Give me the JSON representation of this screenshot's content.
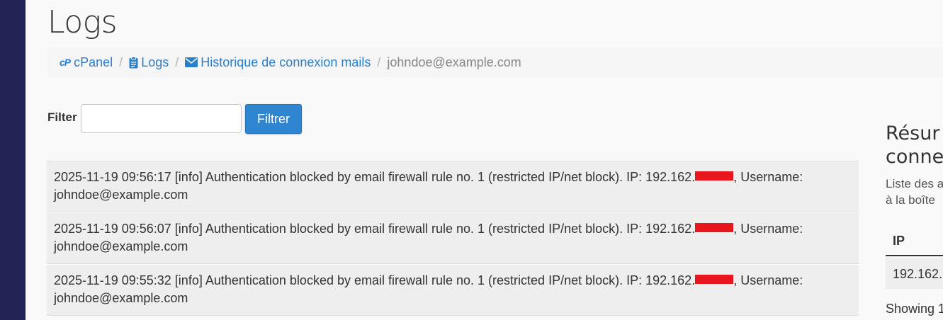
{
  "page": {
    "title": "Logs"
  },
  "breadcrumb": {
    "items": [
      {
        "label": "cPanel",
        "icon": "cpanel-logo-icon"
      },
      {
        "label": "Logs",
        "icon": "clipboard-icon"
      },
      {
        "label": "Historique de connexion mails",
        "icon": "envelope-icon"
      }
    ],
    "current": "johndoe@example.com",
    "separator": "/",
    "cpanel_mark": "cP"
  },
  "filter": {
    "label": "Filter",
    "value": "",
    "placeholder": "",
    "button_label": "Filtrer"
  },
  "logs": [
    {
      "text_before": "2025-11-19 09:56:17 [info] Authentication blocked by email firewall rule no. 1 (restricted IP/net block). IP: 192.162.",
      "text_after": ", Username: johndoe@example.com"
    },
    {
      "text_before": "2025-11-19 09:56:07 [info] Authentication blocked by email firewall rule no. 1 (restricted IP/net block). IP: 192.162.",
      "text_after": ", Username: johndoe@example.com"
    },
    {
      "text_before": "2025-11-19 09:55:32 [info] Authentication blocked by email firewall rule no. 1 (restricted IP/net block). IP: 192.162.",
      "text_after": ", Username: johndoe@example.com"
    }
  ],
  "summary": {
    "title": "Résur\nconne",
    "description": "Liste des a\nà la boîte",
    "ip_header": "IP",
    "ip_value": "192.162.",
    "showing": "Showing 1"
  },
  "colors": {
    "sidebar": "#1f2455",
    "link": "#2a7fc9",
    "button": "#2f86d0",
    "redaction": "#e8161d"
  }
}
